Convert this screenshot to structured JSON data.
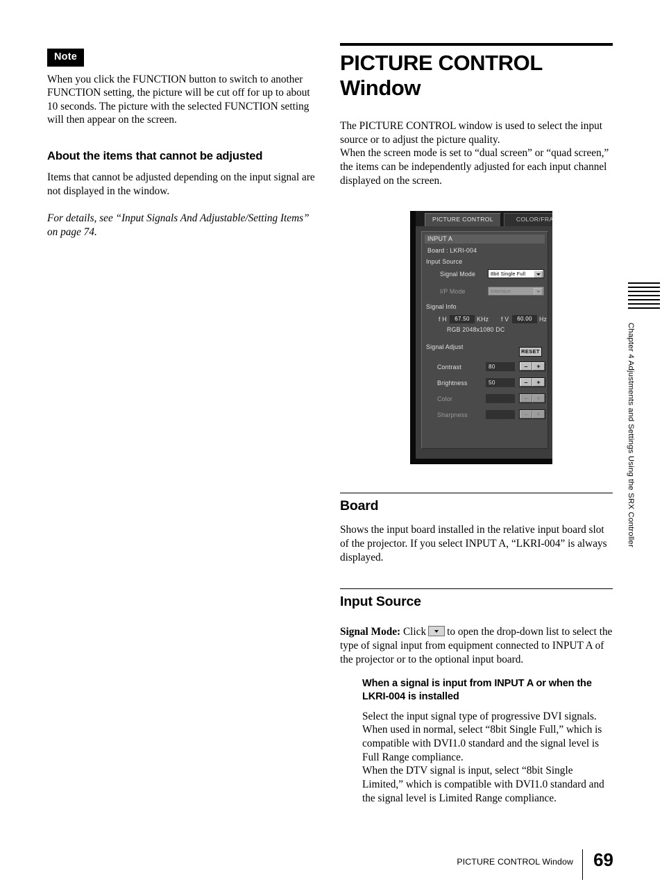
{
  "left_column": {
    "note_badge": "Note",
    "note_body": "When you click the FUNCTION button to switch to another FUNCTION setting, the picture will be cut off for up to about 10 seconds. The picture with the selected FUNCTION setting will then appear on the screen.",
    "section_heading": "About the items that cannot be adjusted",
    "section_body": "Items that cannot be adjusted depending on the input signal are not displayed in the window.",
    "cross_reference": "For details, see “Input Signals And Adjustable/Setting Items” on page 74."
  },
  "right_column": {
    "title": "PICTURE CONTROL Window",
    "intro": "The PICTURE CONTROL window is used to select the input source or to adjust the picture quality.\nWhen the screen mode is set to “dual screen” or “quad screen,” the items can be independently adjusted for each input channel displayed on the screen.",
    "board_heading": "Board",
    "board_body": "Shows the input board installed in the relative input board slot of the projector. If you select INPUT A, “LKRI-004” is always displayed.",
    "input_source_heading": "Input Source",
    "signal_mode_label": "Signal Mode:",
    "signal_mode_click": "Click",
    "signal_mode_rest": "to open the drop-down list to select the type of signal input from equipment connected to INPUT A of the projector or to the optional input board.",
    "subheading_input_a": "When a signal is input from INPUT A or when the LKRI-004 is installed",
    "subbody_input_a": "Select the input signal type of progressive DVI signals.\nWhen used in normal, select “8bit Single Full,” which is compatible with DVI1.0 standard and the signal level is Full Range compliance.\nWhen the DTV signal is input, select “8bit Single Limited,” which is compatible with DVI1.0 standard and the signal level is Limited Range compliance."
  },
  "screenshot": {
    "tabs": [
      {
        "label": "PICTURE CONTROL",
        "active": true
      },
      {
        "label": "COLOR/FRAM",
        "active": false
      }
    ],
    "input_header": "INPUT A",
    "board_row": "Board : LKRI-004",
    "input_source_group": "Input Source",
    "signal_mode_label": "Signal Mode",
    "signal_mode_value": "8bit Single Full",
    "ip_mode_label": "I/P Mode",
    "ip_mode_value": "Interlace",
    "signal_info_group": "Signal Info",
    "fh_label": "f H",
    "fh_value": "67.50",
    "fh_unit": "KHz",
    "fv_label": "f V",
    "fv_value": "60.00",
    "fv_unit": "Hz",
    "format_line": "RGB  2048x1080 DC",
    "signal_adjust_group": "Signal Adjust",
    "reset_label": "RESET",
    "adjust_rows": [
      {
        "label": "Contrast",
        "value": "80",
        "enabled": true
      },
      {
        "label": "Brightness",
        "value": "50",
        "enabled": true
      },
      {
        "label": "Color",
        "value": "",
        "enabled": false
      },
      {
        "label": "Sharpness",
        "value": "",
        "enabled": false
      }
    ],
    "minus_label": "–",
    "plus_label": "+"
  },
  "side_tab": {
    "text": "Chapter 4  Adjustments and Settings Using the SRX Controller"
  },
  "footer": {
    "running_title": "PICTURE CONTROL Window",
    "page_number": "69"
  }
}
